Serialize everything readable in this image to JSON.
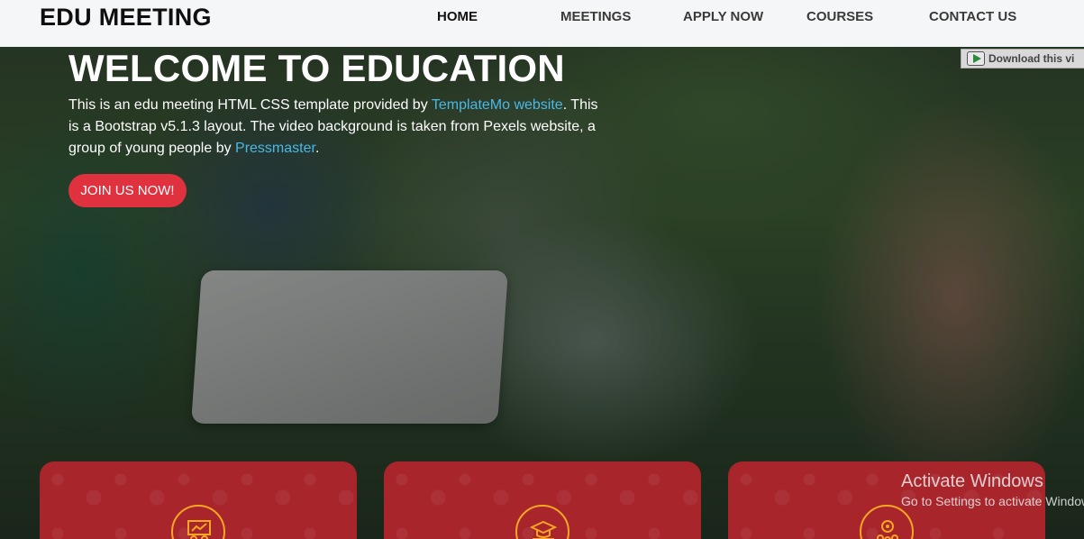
{
  "header": {
    "logo": "EDU MEETING",
    "nav": [
      {
        "label": "HOME",
        "active": true
      },
      {
        "label": "MEETINGS",
        "active": false
      },
      {
        "label": "APPLY NOW",
        "active": false
      },
      {
        "label": "COURSES",
        "active": false
      },
      {
        "label": "CONTACT US",
        "active": false
      }
    ]
  },
  "download_chip": {
    "label": "Download this vi"
  },
  "hero": {
    "title": "WELCOME TO EDUCATION",
    "text_part1": "This is an edu meeting HTML CSS template provided by ",
    "link1": "TemplateMo website",
    "text_part2": ". This is a Bootstrap v5.1.3 layout. The video background is taken from Pexels website, a group of young people by ",
    "link2": "Pressmaster",
    "text_part3": ".",
    "cta": "JOIN US NOW!"
  },
  "cards": [
    {
      "icon": "presentation-icon"
    },
    {
      "icon": "graduation-cap-icon"
    },
    {
      "icon": "people-gear-icon"
    }
  ],
  "watermark": {
    "line1": "Activate Windows",
    "line2": "Go to Settings to activate Windows."
  },
  "colors": {
    "accent": "#e0313f",
    "card": "#a8252c",
    "link": "#49b8e6",
    "icon_ring": "#f5a623"
  }
}
